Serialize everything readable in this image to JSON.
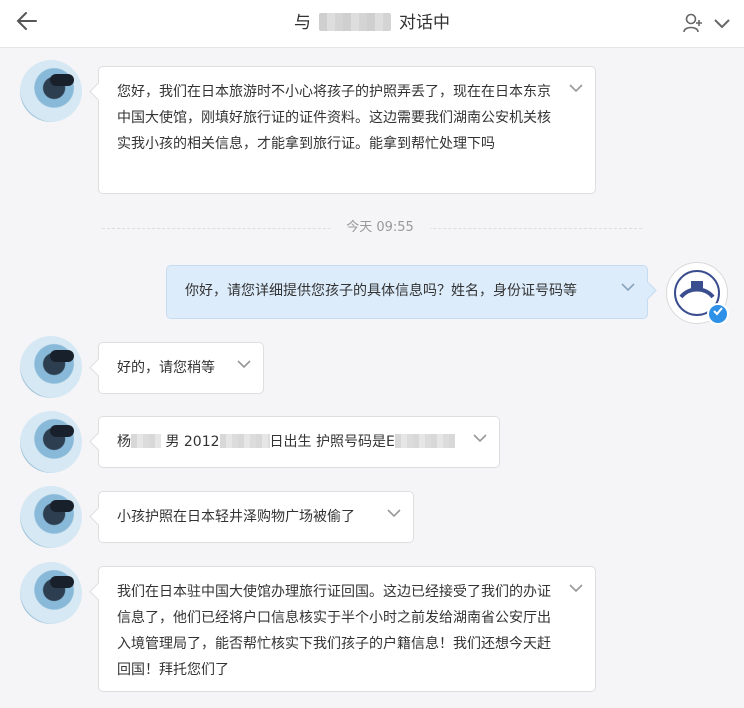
{
  "header": {
    "back_icon": "arrow-left-icon",
    "title_prefix": "与",
    "title_suffix": "对话中",
    "user_icon": "add-user-icon",
    "menu_icon": "chevron-down-icon"
  },
  "timestamp": "今天 09:55",
  "messages": [
    {
      "from": "other",
      "text": "您好，我们在日本旅游时不小心将孩子的护照弄丢了，现在在日本东京中国大使馆，刚填好旅行证的证件资料。这边需要我们湖南公安机关核实我小孩的相关信息，才能拿到旅行证。能拿到帮忙处理下吗"
    },
    {
      "from": "me",
      "text": "你好，请您详细提供您孩子的具体信息吗？姓名，身份证号码等"
    },
    {
      "from": "other",
      "text": "好的，请您稍等"
    },
    {
      "from": "other",
      "parts": [
        "杨",
        "男 2012",
        "日出生 护照号码是E"
      ]
    },
    {
      "from": "other",
      "text": "小孩护照在日本轻井泽购物广场被偷了"
    },
    {
      "from": "other",
      "text": "我们在日本驻中国大使馆办理旅行证回国。这边已经接受了我们的办证信息了，他们已经将户口信息核实于半个小时之前发给湖南省公安厅出入境管理局了，能否帮忙核实下我们孩子的户籍信息！我们还想今天赶回国！拜托您们了"
    }
  ],
  "colors": {
    "my_bubble": "#dcecfb",
    "badge": "#2e90e6"
  }
}
